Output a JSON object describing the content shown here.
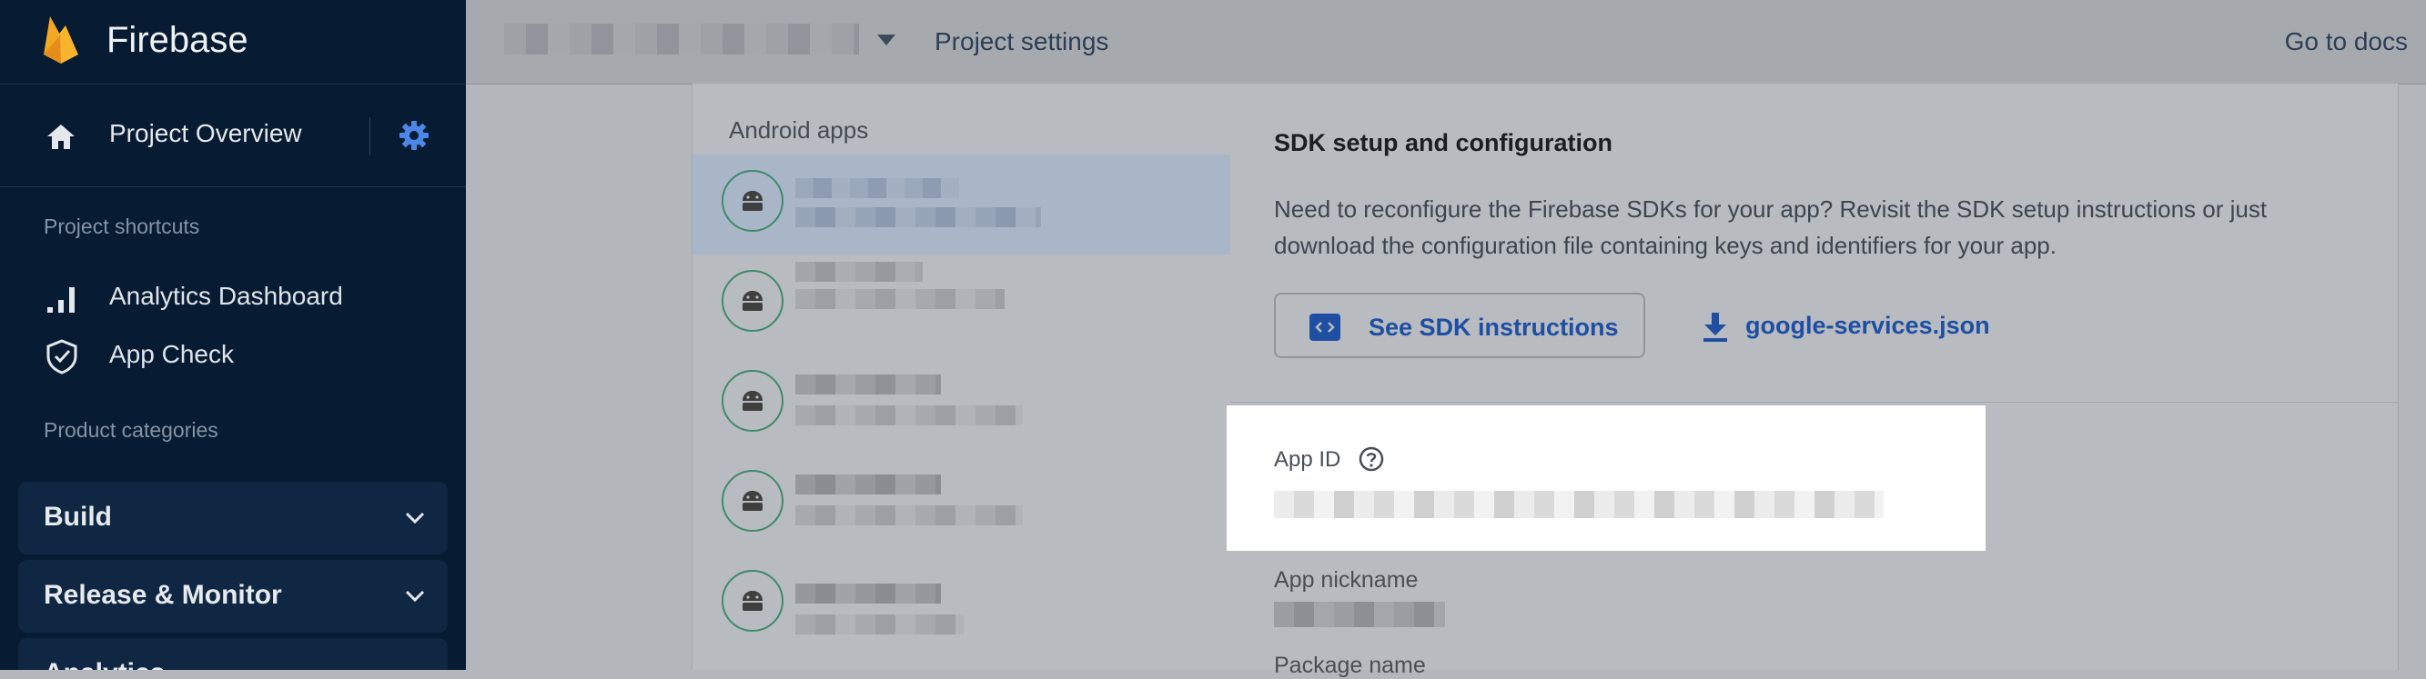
{
  "colors": {
    "sidebar_bg": "#071c33",
    "accent_blue": "#1f4fa3",
    "android_green": "#3f8a69",
    "firebase_orange": "#f5a623"
  },
  "brand": {
    "name": "Firebase",
    "icon": "firebase-flame-icon"
  },
  "sidebar": {
    "overview_label": "Project Overview",
    "shortcuts_title": "Project shortcuts",
    "shortcuts": [
      {
        "label": "Analytics Dashboard",
        "icon": "bar-chart-icon"
      },
      {
        "label": "App Check",
        "icon": "shield-check-icon"
      }
    ],
    "categories_title": "Product categories",
    "categories": [
      {
        "label": "Build"
      },
      {
        "label": "Release & Monitor"
      },
      {
        "label": "Analytics"
      }
    ]
  },
  "topbar": {
    "project_settings": "Project settings",
    "docs": "Go to docs"
  },
  "apps": {
    "title": "Android apps"
  },
  "sdk": {
    "title": "SDK setup and configuration",
    "description": "Need to reconfigure the Firebase SDKs for your app? Revisit the SDK setup instructions or just download the configuration file containing keys and identifiers for your app.",
    "instructions_button": "See SDK instructions",
    "download_button": "google-services.json"
  },
  "details": {
    "app_id_label": "App ID",
    "nickname_label": "App nickname",
    "package_label": "Package name"
  }
}
